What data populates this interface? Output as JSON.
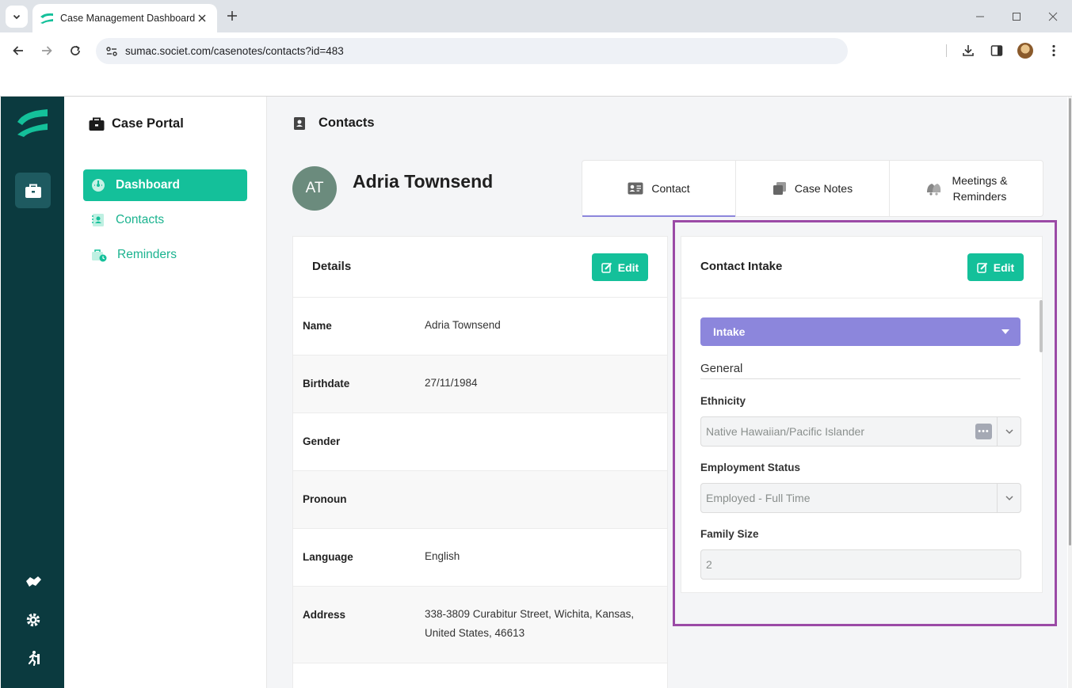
{
  "browser": {
    "tab_title": "Case Management Dashboard",
    "url": "sumac.societ.com/casenotes/contacts?id=483"
  },
  "sidenav": {
    "portal_title": "Case Portal",
    "items": [
      {
        "label": "Dashboard",
        "active": true
      },
      {
        "label": "Contacts",
        "active": false
      },
      {
        "label": "Reminders",
        "active": false
      }
    ]
  },
  "page": {
    "title": "Contacts"
  },
  "contact": {
    "initials": "AT",
    "name": "Adria Townsend"
  },
  "tabs": [
    {
      "label": "Contact",
      "active": true
    },
    {
      "label": "Case Notes",
      "active": false
    },
    {
      "label_line1": "Meetings &",
      "label_line2": "Reminders",
      "active": false
    }
  ],
  "details": {
    "title": "Details",
    "edit_label": "Edit",
    "rows": [
      {
        "label": "Name",
        "value": "Adria Townsend"
      },
      {
        "label": "Birthdate",
        "value": "27/11/1984"
      },
      {
        "label": "Gender",
        "value": ""
      },
      {
        "label": "Pronoun",
        "value": ""
      },
      {
        "label": "Language",
        "value": "English"
      },
      {
        "label": "Address",
        "value_line1": "338-3809 Curabitur Street, Wichita, Kansas,",
        "value_line2": "United States, 46613"
      }
    ]
  },
  "intake": {
    "title": "Contact Intake",
    "edit_label": "Edit",
    "dropdown_label": "Intake",
    "section": "General",
    "fields": [
      {
        "label": "Ethnicity",
        "value": "Native Hawaiian/Pacific Islander"
      },
      {
        "label": "Employment Status",
        "value": "Employed - Full Time"
      },
      {
        "label": "Family Size",
        "value": "2"
      }
    ]
  },
  "colors": {
    "brand_teal": "#14c09a",
    "rail_dark": "#0b3a3f",
    "intake_purple": "#8c86dc",
    "highlight": "#9b4aa6"
  }
}
